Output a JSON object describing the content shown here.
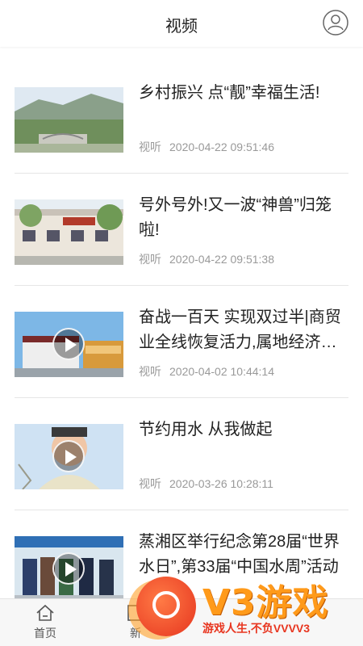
{
  "header": {
    "title": "视频"
  },
  "items": [
    {
      "title": "乡村振兴 点“靓”幸福生活!",
      "source": "视听",
      "time": "2020-04-22 09:51:46",
      "video": false
    },
    {
      "title": "号外号外!又一波“神兽”归笼啦!",
      "source": "视听",
      "time": "2020-04-22 09:51:38",
      "video": false
    },
    {
      "title": "奋战一百天 实现双过半|商贸业全线恢复活力,属地经济持续回暖",
      "source": "视听",
      "time": "2020-04-02 10:44:14",
      "video": true
    },
    {
      "title": "节约用水 从我做起",
      "source": "视听",
      "time": "2020-03-26 10:28:11",
      "video": true
    },
    {
      "title": "蒸湘区举行纪念第28届“世界水日”,第33届“中国水周”活动",
      "source": "视听",
      "time": "",
      "video": true
    }
  ],
  "tabbar": {
    "home": "首页",
    "news": "新"
  },
  "watermark": {
    "brand": "V3游戏",
    "slogan": "游戏人生,不负VVVV3"
  }
}
